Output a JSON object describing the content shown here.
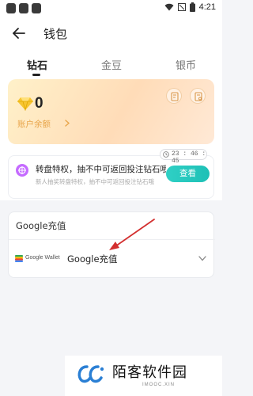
{
  "status_bar": {
    "time": "4:21"
  },
  "header": {
    "title": "钱包"
  },
  "tabs": [
    {
      "label": "钻石",
      "active": true
    },
    {
      "label": "金豆",
      "active": false
    },
    {
      "label": "银币",
      "active": false
    }
  ],
  "balance_card": {
    "amount": "0",
    "label": "账户余额"
  },
  "promo": {
    "title": "转盘特权，抽不中可返回投注钻石哦",
    "subtitle": "新人抽奖转盘特权，抽不中可返回投注钻石哦",
    "countdown": "23 : 46 : 45",
    "button_label": "查看"
  },
  "google_pay": {
    "header": "Google充值",
    "wallet_label": "Google Wallet",
    "option_label": "Google充值"
  },
  "watermark": {
    "name": "陌客软件园",
    "domain": "IMOOC.XIN"
  },
  "colors": {
    "accent": "#22c7bd",
    "gold": "#e8a54a",
    "annotation_arrow": "#d32f2f"
  }
}
